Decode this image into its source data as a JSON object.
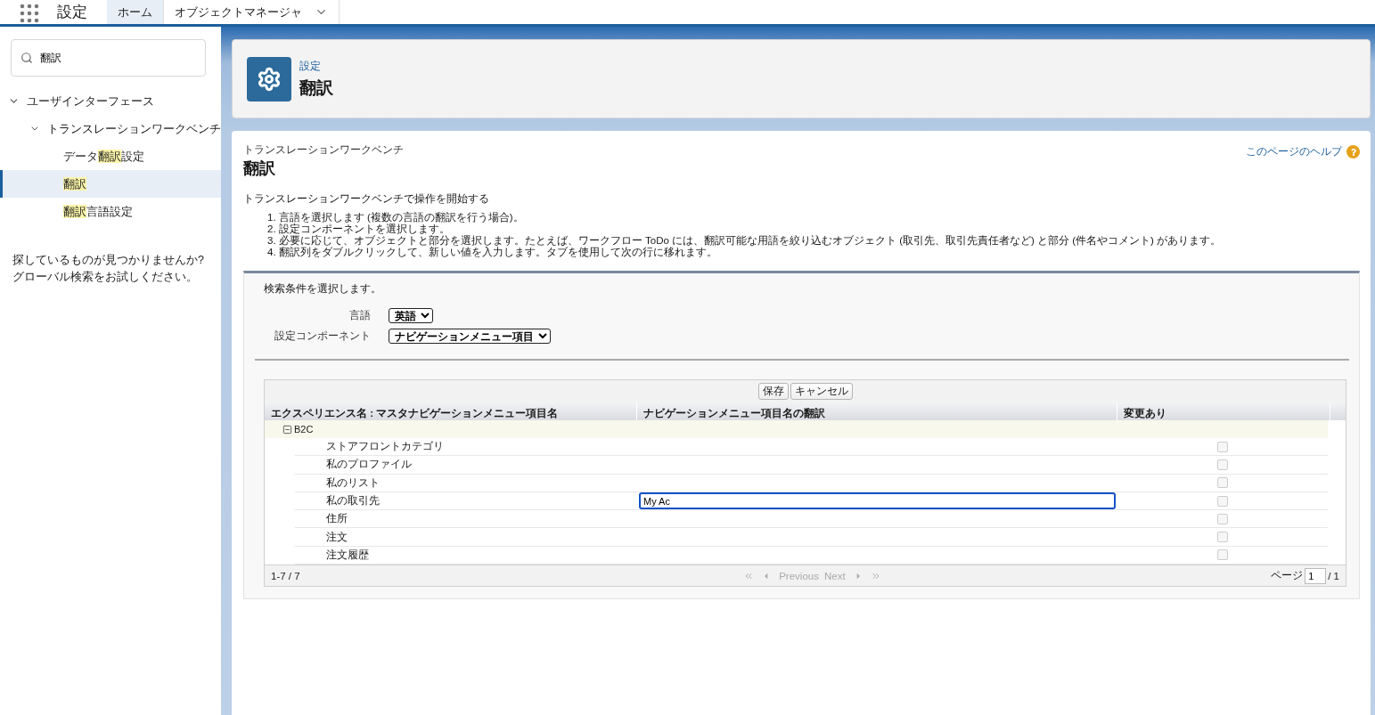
{
  "app_bar": {
    "title": "設定",
    "tabs": [
      {
        "label": "ホーム",
        "selected": true,
        "has_menu": false
      },
      {
        "label": "オブジェクトマネージャ",
        "selected": false,
        "has_menu": true
      }
    ]
  },
  "sidebar": {
    "search": {
      "value": "翻訳"
    },
    "tree": [
      {
        "label": [
          {
            "text": "ユーザインターフェース",
            "highlight": false
          }
        ],
        "expanded": true,
        "selected": false,
        "children": [
          {
            "label": [
              {
                "text": "トランスレーションワークベンチ",
                "highlight": false
              }
            ],
            "expanded": true,
            "selected": false,
            "children": [
              {
                "label": [
                  {
                    "text": "データ",
                    "highlight": false
                  },
                  {
                    "text": "翻訳",
                    "highlight": true
                  },
                  {
                    "text": "設定",
                    "highlight": false
                  }
                ],
                "selected": false
              },
              {
                "label": [
                  {
                    "text": "翻訳",
                    "highlight": true
                  }
                ],
                "selected": true
              },
              {
                "label": [
                  {
                    "text": "翻訳",
                    "highlight": true
                  },
                  {
                    "text": "言語設定",
                    "highlight": false
                  }
                ],
                "selected": false
              }
            ]
          }
        ]
      }
    ],
    "help_lines": [
      "探しているものが見つかりませんか?",
      "グローバル検索をお試しください。"
    ]
  },
  "header": {
    "breadcrumb": "設定",
    "title": "翻訳"
  },
  "content": {
    "eyebrow": "トランスレーションワークベンチ",
    "title": "翻訳",
    "help_link": "このページのヘルプ",
    "intro": "トランスレーションワークベンチで操作を開始する",
    "steps": [
      "1. 言語を選択します (複数の言語の翻訳を行う場合)。",
      "2. 設定コンポーネントを選択します。",
      "3. 必要に応じて、オブジェクトと部分を選択します。たとえば、ワークフロー ToDo には、翻訳可能な用語を絞り込むオブジェクト (取引先、取引先責任者など) と部分 (件名やコメント) があります。",
      "4. 翻訳列をダブルクリックして、新しい値を入力します。タブを使用して次の行に移れます。"
    ]
  },
  "filters": {
    "heading": "検索条件を選択します。",
    "fields": [
      {
        "label": "言語",
        "value": "英語"
      },
      {
        "label": "設定コンポーネント",
        "value": "ナビゲーションメニュー項目"
      }
    ]
  },
  "grid": {
    "buttons": [
      "保存",
      "キャンセル"
    ],
    "columns": [
      "エクスペリエンス名 : マスタナビゲーションメニュー項目名",
      "ナビゲーションメニュー項目名の翻訳",
      "変更あり"
    ],
    "groups": [
      {
        "label": "B2C",
        "expanded": true,
        "rows": [
          {
            "name": "ストアフロントカテゴリ",
            "editing": false,
            "changed": false
          },
          {
            "name": "私のプロファイル",
            "editing": false,
            "changed": false
          },
          {
            "name": "私のリスト",
            "editing": false,
            "changed": false
          },
          {
            "name": "私の取引先",
            "translation": "My Ac",
            "editing": true,
            "changed": false
          },
          {
            "name": "住所",
            "editing": false,
            "changed": false
          },
          {
            "name": "注文",
            "editing": false,
            "changed": false
          },
          {
            "name": "注文履歴",
            "editing": false,
            "changed": false
          }
        ]
      }
    ],
    "footer": {
      "range": "1-7 / 7",
      "previous": "Previous",
      "next": "Next",
      "page_label": "ページ",
      "page": "1",
      "total": "/ 1"
    }
  }
}
